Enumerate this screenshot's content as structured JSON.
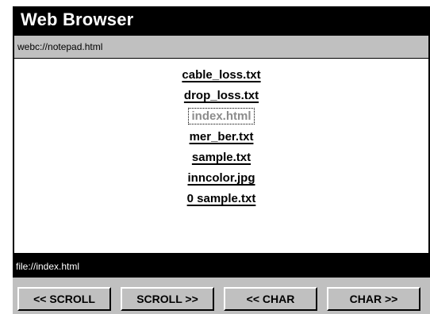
{
  "window": {
    "title": "Web Browser"
  },
  "address_bar": {
    "url": "webc://notepad.html"
  },
  "file_list": {
    "items": [
      {
        "label": "cable_loss.txt",
        "selected": false
      },
      {
        "label": "drop_loss.txt",
        "selected": false
      },
      {
        "label": "index.html",
        "selected": true
      },
      {
        "label": "mer_ber.txt",
        "selected": false
      },
      {
        "label": "sample.txt",
        "selected": false
      },
      {
        "label": "inncolor.jpg",
        "selected": false
      },
      {
        "label": "0 sample.txt",
        "selected": false
      }
    ]
  },
  "status_bar": {
    "text": "file://index.html"
  },
  "buttons": {
    "scroll_left": "<< SCROLL",
    "scroll_right": "SCROLL >>",
    "char_left": "<< CHAR",
    "char_right": "CHAR >>"
  },
  "colors": {
    "frame": "#000000",
    "panel_gray": "#c0c0c0",
    "content_bg": "#ffffff",
    "selected_text": "#8c8c8c"
  }
}
